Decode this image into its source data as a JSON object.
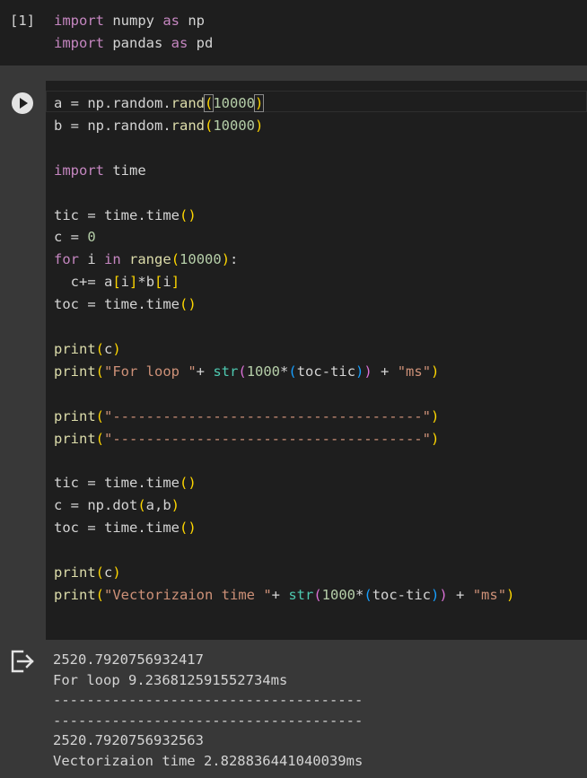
{
  "cells": [
    {
      "execution_count": "[1]",
      "source": "import numpy as np\nimport pandas as pd"
    },
    {
      "source": "a = np.random.rand(10000)\nb = np.random.rand(10000)\n\nimport time\n\ntic = time.time()\nc = 0\nfor i in range(10000):\n  c+= a[i]*b[i]\ntoc = time.time()\n\nprint(c)\nprint(\"For loop \"+ str(1000*(toc-tic)) + \"ms\")\n\nprint(\"-------------------------------------\")\nprint(\"-------------------------------------\")\n\ntic = time.time()\nc = np.dot(a,b)\ntoc = time.time()\n\nprint(c)\nprint(\"Vectorizaion time \"+ str(1000*(toc-tic)) + \"ms\")",
      "run_button": {
        "icon": "play-icon"
      },
      "output": {
        "icon": "output-toggle-icon",
        "lines": [
          "2520.7920756932417",
          "For loop 9.236812591552734ms",
          "-------------------------------------",
          "-------------------------------------",
          "2520.7920756932563",
          "Vectorizaion time 2.828836441040039ms"
        ]
      }
    }
  ],
  "colors": {
    "editor_background": "#1e1e1e",
    "gutter_background": "#383838",
    "keyword": "#c586c0",
    "builtin_function": "#dcdcaa",
    "builtin_type": "#4ec9b0",
    "number": "#b5cea8",
    "string": "#ce9178",
    "text": "#d4d4d4"
  }
}
